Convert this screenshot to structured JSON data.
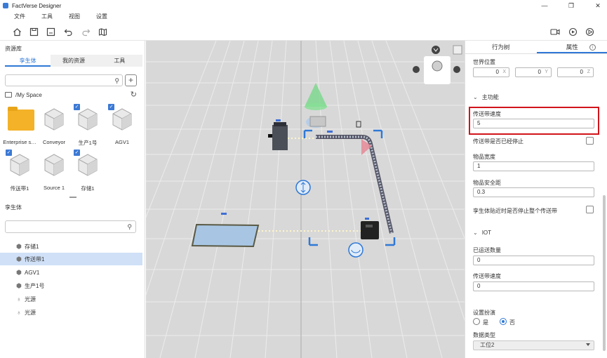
{
  "app": {
    "title": "FactVerse Designer"
  },
  "menu": [
    "文件",
    "工具",
    "视图",
    "设置"
  ],
  "left_panel": {
    "header": "资源库",
    "tabs": [
      "孪生体",
      "我的资源",
      "工具"
    ],
    "path": "/My Space",
    "assets": [
      {
        "label": "Enterprise s…",
        "type": "folder",
        "checked": false
      },
      {
        "label": "Conveyor",
        "type": "cube",
        "checked": false
      },
      {
        "label": "生产1号",
        "type": "cube",
        "checked": true
      },
      {
        "label": "AGV1",
        "type": "cube",
        "checked": true
      },
      {
        "label": "传送带1",
        "type": "cube",
        "checked": true
      },
      {
        "label": "Source 1",
        "type": "cube",
        "checked": false
      },
      {
        "label": "存储1",
        "type": "cube",
        "checked": true
      }
    ],
    "tree_header": "孪生体",
    "tree": [
      {
        "label": "存储1",
        "icon": "hex-icon",
        "selected": false
      },
      {
        "label": "传送带1",
        "icon": "hex-icon",
        "selected": true
      },
      {
        "label": "AGV1",
        "icon": "hex-icon",
        "selected": false
      },
      {
        "label": "生产1号",
        "icon": "hex-icon",
        "selected": false
      },
      {
        "label": "光源",
        "icon": "bulb-icon",
        "selected": false
      },
      {
        "label": "光源",
        "icon": "bulb-icon",
        "selected": false
      }
    ]
  },
  "right_panel": {
    "tabs": [
      "行为树",
      "属性"
    ],
    "world_pos_label": "世界位置",
    "pos": {
      "x": "0",
      "y": "0",
      "z": "0",
      "x_axis": "X",
      "y_axis": "Y",
      "z_axis": "Z"
    },
    "main_section": "主功能",
    "belt_speed_label": "传送带速度",
    "belt_speed": "5",
    "belt_stopped_label": "传送带是否已经停止",
    "item_width_label": "物品宽度",
    "item_width": "1",
    "item_safe_label": "物品安全距",
    "item_safe": "0.3",
    "stop_close_label": "孪生体贴近时是否停止整个传送带",
    "iot_section": "IOT",
    "shipped_label": "已运送数量",
    "shipped": "0",
    "belt_speed2_label": "传送带速度",
    "belt_speed2": "0",
    "sim_label": "设置扮演",
    "yes": "是",
    "no": "否",
    "datatype_label": "数据类型",
    "datatype_value": "工位2"
  },
  "colors": {
    "accent": "#2f78d6",
    "highlight": "#d1141b",
    "folder": "#f3b228"
  }
}
